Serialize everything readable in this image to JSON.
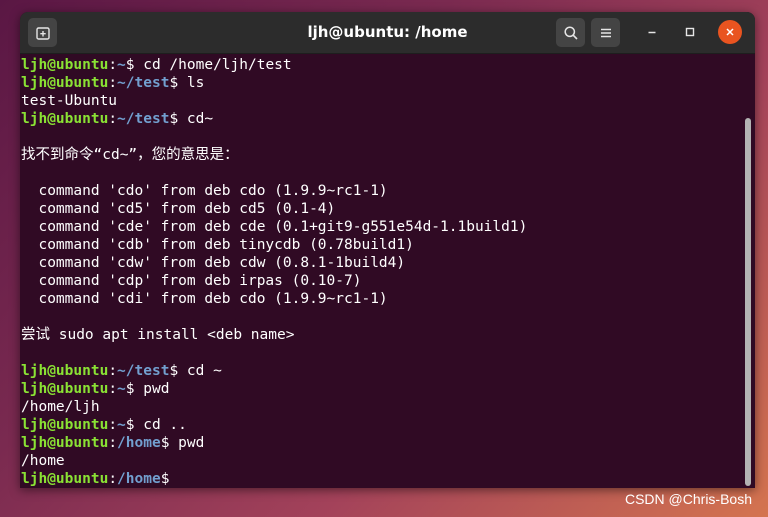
{
  "window": {
    "title": "ljh@ubuntu: /home",
    "buttons": {
      "new_tab_icon": "new-tab-icon",
      "search_icon": "search-icon",
      "menu_icon": "hamburger-menu-icon",
      "minimize_icon": "minimize-icon",
      "maximize_icon": "maximize-icon",
      "close_icon": "close-icon"
    },
    "colors": {
      "background": "#300a24",
      "user_host": "#8ae234",
      "path": "#729fcf",
      "close_accent": "#e95420"
    }
  },
  "terminal": {
    "lines": [
      {
        "user": "ljh@ubuntu",
        "sep": ":",
        "path": "~",
        "cmd": "$ cd /home/ljh/test"
      },
      {
        "user": "ljh@ubuntu",
        "sep": ":",
        "path": "~/test",
        "cmd": "$ ls"
      },
      {
        "text": "test-Ubuntu"
      },
      {
        "user": "ljh@ubuntu",
        "sep": ":",
        "path": "~/test",
        "cmd": "$ cd~"
      },
      {
        "text": ""
      },
      {
        "text": "找不到命令“cd~”，您的意思是："
      },
      {
        "text": ""
      },
      {
        "text": "  command 'cdo' from deb cdo (1.9.9~rc1-1)"
      },
      {
        "text": "  command 'cd5' from deb cd5 (0.1-4)"
      },
      {
        "text": "  command 'cde' from deb cde (0.1+git9-g551e54d-1.1build1)"
      },
      {
        "text": "  command 'cdb' from deb tinycdb (0.78build1)"
      },
      {
        "text": "  command 'cdw' from deb cdw (0.8.1-1build4)"
      },
      {
        "text": "  command 'cdp' from deb irpas (0.10-7)"
      },
      {
        "text": "  command 'cdi' from deb cdo (1.9.9~rc1-1)"
      },
      {
        "text": ""
      },
      {
        "text": "尝试 sudo apt install <deb name>"
      },
      {
        "text": ""
      },
      {
        "user": "ljh@ubuntu",
        "sep": ":",
        "path": "~/test",
        "cmd": "$ cd ~"
      },
      {
        "user": "ljh@ubuntu",
        "sep": ":",
        "path": "~",
        "cmd": "$ pwd"
      },
      {
        "text": "/home/ljh"
      },
      {
        "user": "ljh@ubuntu",
        "sep": ":",
        "path": "~",
        "cmd": "$ cd .."
      },
      {
        "user": "ljh@ubuntu",
        "sep": ":",
        "path": "/home",
        "cmd": "$ pwd"
      },
      {
        "text": "/home"
      },
      {
        "user": "ljh@ubuntu",
        "sep": ":",
        "path": "/home",
        "cmd": "$"
      }
    ]
  },
  "watermark": "CSDN @Chris-Bosh"
}
